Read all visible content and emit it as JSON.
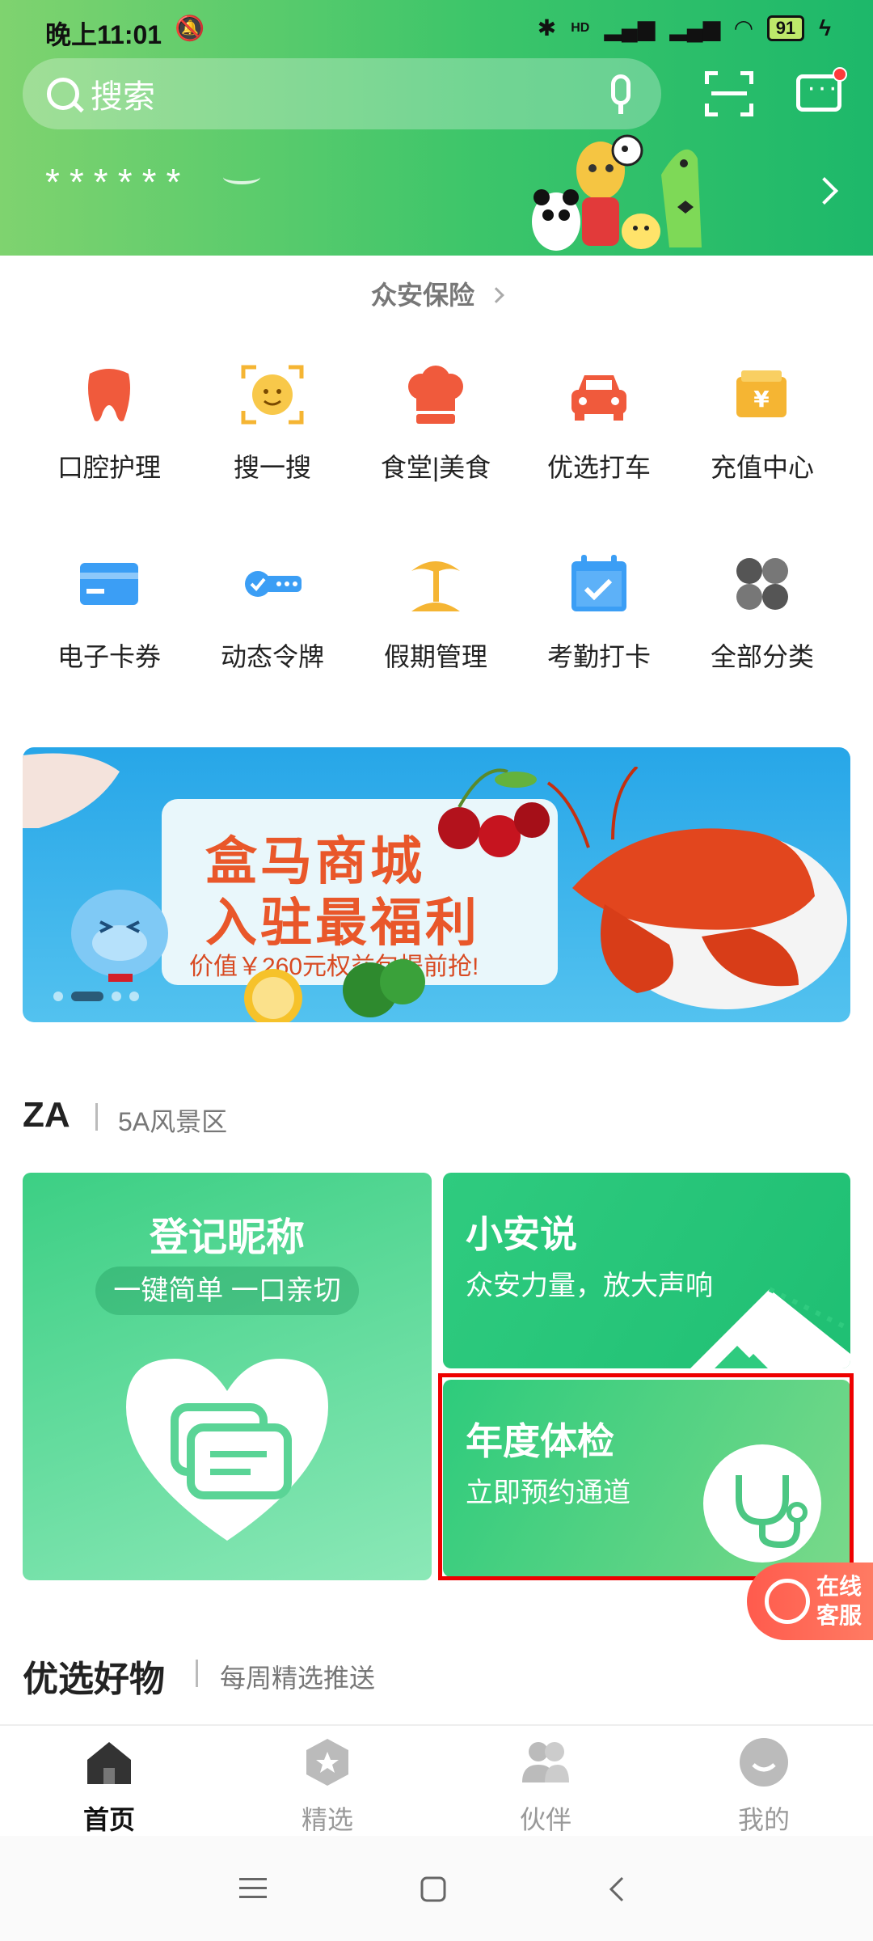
{
  "status_bar": {
    "time": "晚上11:01",
    "network": "HD",
    "battery": "91"
  },
  "header": {
    "search_placeholder": "搜索",
    "masked_value": "******"
  },
  "insurance_link": "众安保险",
  "grid": [
    {
      "label": "口腔护理",
      "icon": "tooth-icon",
      "color": "#f05a3c"
    },
    {
      "label": "搜一搜",
      "icon": "face-scan-icon",
      "color": "#f5b533"
    },
    {
      "label": "食堂|美食",
      "icon": "chef-hat-icon",
      "color": "#f05a3c"
    },
    {
      "label": "优选打车",
      "icon": "car-icon",
      "color": "#f05a3c"
    },
    {
      "label": "充值中心",
      "icon": "wallet-icon",
      "color": "#f5b533"
    },
    {
      "label": "电子卡券",
      "icon": "card-icon",
      "color": "#3b9ef5"
    },
    {
      "label": "动态令牌",
      "icon": "token-key-icon",
      "color": "#3b9ef5"
    },
    {
      "label": "假期管理",
      "icon": "palm-tree-icon",
      "color": "#f5b533"
    },
    {
      "label": "考勤打卡",
      "icon": "calendar-check-icon",
      "color": "#3b9ef5"
    },
    {
      "label": "全部分类",
      "icon": "grid-icon",
      "color": "#555555"
    }
  ],
  "banner": {
    "title_line1": "盒马商城",
    "title_line2": "入驻最福利",
    "subtitle": "价值￥260元权益包提前抢!"
  },
  "section_za": {
    "title": "ZA",
    "subtitle": "5A风景区"
  },
  "cards": {
    "nickname": {
      "title": "登记昵称",
      "pill": "一键简单 一口亲切"
    },
    "xiaoan": {
      "title": "小安说",
      "subtitle": "众安力量，放大声响"
    },
    "checkup": {
      "title": "年度体检",
      "subtitle": "立即预约通道"
    }
  },
  "chat_fab": {
    "line1": "在线",
    "line2": "客服"
  },
  "section_goods": {
    "title": "优选好物",
    "subtitle": "每周精选推送"
  },
  "tabs": [
    {
      "label": "首页",
      "icon": "home-icon",
      "active": true
    },
    {
      "label": "精选",
      "icon": "star-hexagon-icon",
      "active": false
    },
    {
      "label": "伙伴",
      "icon": "partners-icon",
      "active": false
    },
    {
      "label": "我的",
      "icon": "profile-icon",
      "active": false
    }
  ]
}
